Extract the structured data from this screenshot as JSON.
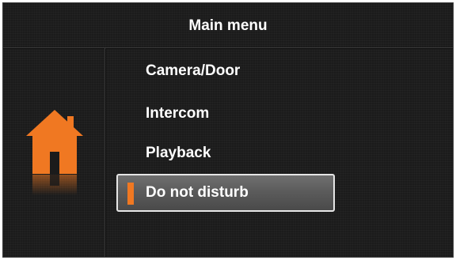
{
  "header": {
    "title": "Main menu"
  },
  "sidebar": {
    "icon": "home-icon",
    "icon_color": "#f07822"
  },
  "menu": {
    "items": [
      {
        "label": "Camera/Door",
        "selected": false
      },
      {
        "label": "Intercom",
        "selected": false
      },
      {
        "label": "Playback",
        "selected": false
      },
      {
        "label": "Do not disturb",
        "selected": true
      }
    ]
  },
  "colors": {
    "accent": "#f07822",
    "background": "#1b1b1b",
    "text": "#ffffff",
    "selection_border": "#e6e6e6"
  }
}
